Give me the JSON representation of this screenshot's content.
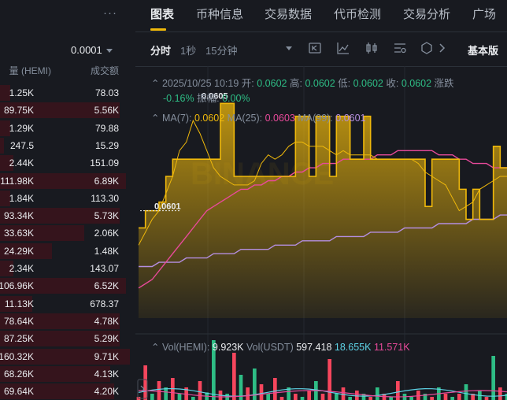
{
  "orderbook": {
    "more_icon": "more-horizontal-icon",
    "precision": "0.0001",
    "col_amount": "量 (HEMI)",
    "col_total": "成交额",
    "rows": [
      {
        "amount": "1.25K",
        "total": "78.03",
        "depth": 0.08
      },
      {
        "amount": "89.75K",
        "total": "5.56K",
        "depth": 0.92
      },
      {
        "amount": "1.29K",
        "total": "79.88",
        "depth": 0.08
      },
      {
        "amount": "247.5",
        "total": "15.29",
        "depth": 0.03
      },
      {
        "amount": "2.44K",
        "total": "151.09",
        "depth": 0.1
      },
      {
        "amount": "111.98K",
        "total": "6.89K",
        "depth": 0.97
      },
      {
        "amount": "1.84K",
        "total": "113.30",
        "depth": 0.08
      },
      {
        "amount": "93.34K",
        "total": "5.73K",
        "depth": 0.92
      },
      {
        "amount": "33.63K",
        "total": "2.06K",
        "depth": 0.65
      },
      {
        "amount": "24.29K",
        "total": "1.48K",
        "depth": 0.4
      },
      {
        "amount": "2.34K",
        "total": "143.07",
        "depth": 0.1
      },
      {
        "amount": "106.96K",
        "total": "6.52K",
        "depth": 0.97
      },
      {
        "amount": "11.13K",
        "total": "678.37",
        "depth": 0.25
      },
      {
        "amount": "78.64K",
        "total": "4.78K",
        "depth": 0.92
      },
      {
        "amount": "87.25K",
        "total": "5.29K",
        "depth": 0.92
      },
      {
        "amount": "160.32K",
        "total": "9.71K",
        "depth": 1.0
      },
      {
        "amount": "68.26K",
        "total": "4.13K",
        "depth": 0.85
      },
      {
        "amount": "69.64K",
        "total": "4.20K",
        "depth": 0.88
      }
    ]
  },
  "nav": {
    "tabs": [
      "图表",
      "币种信息",
      "交易数据",
      "代币检测",
      "交易分析",
      "广场"
    ]
  },
  "toolbar": {
    "timeframes": [
      "分时",
      "1秒",
      "15分钟"
    ],
    "icons": [
      "dropdown-caret-icon",
      "replay-icon",
      "indicator-icon",
      "candlestick-icon",
      "settings-list-icon",
      "hexagon-icon",
      "chevron-right-icon"
    ],
    "basic": "基本版"
  },
  "ohlc": {
    "datetime": "2025/10/25 10:19",
    "open_label": "开:",
    "open": "0.0602",
    "high_label": "高:",
    "high": "0.0602",
    "low_label": "低:",
    "low": "0.0602",
    "close_label": "收:",
    "close": "0.0602",
    "change_label": "涨跌",
    "change_pct": "-0.16%",
    "amp_label": "振幅:",
    "amp": "0.00%"
  },
  "ma": {
    "ma7_label": "MA(7):",
    "ma7": "0.0602",
    "ma25_label": "MA(25):",
    "ma25": "0.0603",
    "ma99_label": "MA(99):",
    "ma99": "0.0601"
  },
  "vol": {
    "hemi_label": "Vol(HEMI):",
    "hemi": "9.923K",
    "usdt_label": "Vol(USDT)",
    "usdt": "597.418",
    "v1": "18.655K",
    "v2": "11.571K"
  },
  "colors": {
    "up": "#2ebd85",
    "down": "#f6465d",
    "accent": "#f0b90b",
    "ma25": "#e84a9a",
    "ma99": "#b48ee0"
  },
  "chart_data": {
    "type": "area",
    "price_labels": [
      "0.0601",
      "0.0605"
    ],
    "watermark": "BINANCE",
    "price": [
      0.06006,
      0.0601,
      0.0601,
      0.06012,
      0.06018,
      0.06022,
      0.06022,
      0.06022,
      0.06022,
      0.06022,
      0.06022,
      0.06022,
      0.06035,
      0.06035,
      0.06018,
      0.06018,
      0.06018,
      0.06018,
      0.06018,
      0.06018,
      0.06018,
      0.06018,
      0.06018,
      0.06032,
      0.06032,
      0.06018,
      0.06032,
      0.06032,
      0.06018,
      0.06032,
      0.06032,
      0.06022,
      0.06022,
      0.06032,
      0.06022,
      0.06022,
      0.06022,
      0.06022,
      0.06022,
      0.06022,
      0.06022,
      0.06022,
      0.06011,
      0.06022,
      0.06022,
      0.06022,
      0.06022,
      0.06015,
      0.06008,
      0.06015,
      0.06008,
      0.06008,
      0.06025,
      0.0602,
      0.0602
    ],
    "ma7": [
      0.06002,
      0.06005,
      0.06008,
      0.0601,
      0.06014,
      0.06018,
      0.06024,
      0.06026,
      0.06031,
      0.06028,
      0.06024,
      0.0602,
      0.06018,
      0.06017,
      0.06016,
      0.06016,
      0.06016,
      0.06017,
      0.06021,
      0.06023,
      0.06022,
      0.06023,
      0.06025,
      0.06026,
      0.06026,
      0.06025,
      0.06025,
      0.06025,
      0.06024,
      0.06023,
      0.06024,
      0.06023,
      0.06023,
      0.06023,
      0.06023,
      0.06022,
      0.06022,
      0.06022,
      0.06022,
      0.06022,
      0.06022,
      0.06021,
      0.06019,
      0.06018,
      0.06017,
      0.06016,
      0.06013,
      0.0601,
      0.06011,
      0.06012,
      0.06015,
      0.06016,
      0.06017,
      0.06018,
      0.06018
    ],
    "ma25": [
      0.05992,
      0.05993,
      0.05994,
      0.05996,
      0.05998,
      0.06,
      0.06002,
      0.06004,
      0.06006,
      0.06008,
      0.0601,
      0.06011,
      0.06012,
      0.06013,
      0.06014,
      0.06015,
      0.06015,
      0.06016,
      0.06016,
      0.06017,
      0.06017,
      0.06018,
      0.06018,
      0.06019,
      0.06019,
      0.0602,
      0.0602,
      0.06021,
      0.06021,
      0.06021,
      0.06022,
      0.06022,
      0.06022,
      0.06022,
      0.06022,
      0.06023,
      0.06023,
      0.06023,
      0.06024,
      0.06024,
      0.06024,
      0.06024,
      0.06024,
      0.06024,
      0.06023,
      0.06023,
      0.06023,
      0.06022,
      0.06022,
      0.06021,
      0.06021,
      0.06021,
      0.0602,
      0.0602,
      0.0602
    ],
    "ma99": [
      0.05997,
      0.05997,
      0.05997,
      0.05998,
      0.05998,
      0.05998,
      0.05998,
      0.05999,
      0.05999,
      0.05999,
      0.05999,
      0.06,
      0.06,
      0.06,
      0.06,
      0.06001,
      0.06001,
      0.06001,
      0.06001,
      0.06001,
      0.06002,
      0.06002,
      0.06002,
      0.06002,
      0.06003,
      0.06003,
      0.06003,
      0.06003,
      0.06003,
      0.06004,
      0.06004,
      0.06004,
      0.06004,
      0.06004,
      0.06005,
      0.06005,
      0.06005,
      0.06005,
      0.06005,
      0.06006,
      0.06006,
      0.06006,
      0.06006,
      0.06006,
      0.06007,
      0.06007,
      0.06007,
      0.06007,
      0.06007,
      0.06008,
      0.06008,
      0.06008,
      0.06008,
      0.06009,
      0.06009
    ],
    "volume": [
      {
        "v": 0.05,
        "up": false
      },
      {
        "v": 0.55,
        "up": false
      },
      {
        "v": 0.1,
        "up": true
      },
      {
        "v": 0.3,
        "up": false
      },
      {
        "v": 0.2,
        "up": true
      },
      {
        "v": 0.35,
        "up": false
      },
      {
        "v": 0.1,
        "up": true
      },
      {
        "v": 0.2,
        "up": false
      },
      {
        "v": 0.05,
        "up": true
      },
      {
        "v": 0.3,
        "up": false
      },
      {
        "v": 0.12,
        "up": true
      },
      {
        "v": 0.95,
        "up": true
      },
      {
        "v": 0.15,
        "up": false
      },
      {
        "v": 0.1,
        "up": true
      },
      {
        "v": 0.75,
        "up": false
      },
      {
        "v": 0.4,
        "up": true
      },
      {
        "v": 0.2,
        "up": false
      },
      {
        "v": 0.5,
        "up": true
      },
      {
        "v": 0.25,
        "up": false
      },
      {
        "v": 0.1,
        "up": true
      },
      {
        "v": 0.35,
        "up": false
      },
      {
        "v": 0.05,
        "up": false
      },
      {
        "v": 0.2,
        "up": true
      },
      {
        "v": 0.1,
        "up": false
      },
      {
        "v": 0.05,
        "up": true
      },
      {
        "v": 0.15,
        "up": false
      },
      {
        "v": 0.3,
        "up": true
      },
      {
        "v": 0.1,
        "up": false
      },
      {
        "v": 0.65,
        "up": false
      },
      {
        "v": 0.1,
        "up": true
      },
      {
        "v": 0.2,
        "up": false
      },
      {
        "v": 0.05,
        "up": true
      },
      {
        "v": 0.15,
        "up": false
      },
      {
        "v": 0.1,
        "up": true
      },
      {
        "v": 0.05,
        "up": false
      },
      {
        "v": 0.2,
        "up": true
      },
      {
        "v": 0.1,
        "up": false
      },
      {
        "v": 0.05,
        "up": true
      },
      {
        "v": 0.3,
        "up": false
      },
      {
        "v": 0.1,
        "up": true
      },
      {
        "v": 0.05,
        "up": true
      },
      {
        "v": 0.15,
        "up": false
      },
      {
        "v": 0.1,
        "up": true
      },
      {
        "v": 0.05,
        "up": false
      },
      {
        "v": 0.2,
        "up": true
      },
      {
        "v": 0.1,
        "up": false
      },
      {
        "v": 0.05,
        "up": true
      },
      {
        "v": 0.1,
        "up": false
      },
      {
        "v": 0.25,
        "up": true
      },
      {
        "v": 0.1,
        "up": false
      },
      {
        "v": 0.15,
        "up": true
      },
      {
        "v": 0.05,
        "up": false
      },
      {
        "v": 0.7,
        "up": true
      },
      {
        "v": 0.2,
        "up": false
      },
      {
        "v": 0.1,
        "up": true
      }
    ]
  }
}
